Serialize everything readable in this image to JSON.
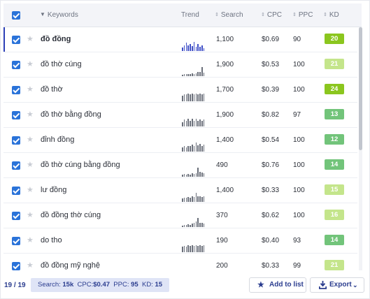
{
  "header": {
    "keywords": "Keywords",
    "trend": "Trend",
    "search": "Search",
    "cpc": "CPC",
    "ppc": "PPC",
    "kd": "KD"
  },
  "rows": [
    {
      "keyword": "đồ đồng",
      "search": "1,100",
      "cpc": "$0.69",
      "ppc": "90",
      "kd": "20",
      "kd_color": "#8bc61e",
      "trend": [
        0.35,
        0.55,
        0.85,
        0.6,
        0.75,
        0.5,
        0.95,
        0.45,
        0.7,
        0.4,
        0.55,
        0.3
      ]
    },
    {
      "keyword": "đồ thờ cúng",
      "search": "1,900",
      "cpc": "$0.53",
      "ppc": "100",
      "kd": "21",
      "kd_color": "#c4e58b",
      "trend": [
        0.15,
        0.2,
        0.2,
        0.25,
        0.2,
        0.3,
        0.25,
        0.3,
        0.4,
        0.45,
        0.95,
        0.35
      ]
    },
    {
      "keyword": "đồ thờ",
      "search": "1,700",
      "cpc": "$0.39",
      "ppc": "100",
      "kd": "24",
      "kd_color": "#8bc61e",
      "trend": [
        0.55,
        0.75,
        0.75,
        0.8,
        0.75,
        0.8,
        0.75,
        0.8,
        0.75,
        0.8,
        0.75,
        0.8
      ]
    },
    {
      "keyword": "đồ thờ bằng đồng",
      "search": "1,900",
      "cpc": "$0.82",
      "ppc": "97",
      "kd": "13",
      "kd_color": "#72c47a",
      "trend": [
        0.4,
        0.75,
        0.6,
        0.8,
        0.6,
        0.8,
        0.6,
        0.8,
        0.6,
        0.75,
        0.6,
        0.7
      ]
    },
    {
      "keyword": "đỉnh đồng",
      "search": "1,400",
      "cpc": "$0.54",
      "ppc": "100",
      "kd": "12",
      "kd_color": "#72c47a",
      "trend": [
        0.4,
        0.55,
        0.45,
        0.6,
        0.55,
        0.7,
        0.6,
        0.9,
        0.65,
        0.8,
        0.6,
        0.7
      ]
    },
    {
      "keyword": "đồ thờ cúng bằng đồng",
      "search": "490",
      "cpc": "$0.76",
      "ppc": "100",
      "kd": "14",
      "kd_color": "#72c47a",
      "trend": [
        0.2,
        0.3,
        0.25,
        0.3,
        0.25,
        0.35,
        0.3,
        0.35,
        0.95,
        0.5,
        0.4,
        0.35
      ]
    },
    {
      "keyword": "lư đồng",
      "search": "1,400",
      "cpc": "$0.33",
      "ppc": "100",
      "kd": "15",
      "kd_color": "#c4e58b",
      "trend": [
        0.35,
        0.45,
        0.4,
        0.5,
        0.45,
        0.55,
        0.5,
        0.95,
        0.55,
        0.6,
        0.5,
        0.55
      ]
    },
    {
      "keyword": "đồ đồng thờ cúng",
      "search": "370",
      "cpc": "$0.62",
      "ppc": "100",
      "kd": "16",
      "kd_color": "#c4e58b",
      "trend": [
        0.15,
        0.25,
        0.2,
        0.3,
        0.25,
        0.35,
        0.4,
        0.55,
        0.95,
        0.45,
        0.4,
        0.35
      ]
    },
    {
      "keyword": "do tho",
      "search": "190",
      "cpc": "$0.40",
      "ppc": "93",
      "kd": "14",
      "kd_color": "#72c47a",
      "trend": [
        0.55,
        0.65,
        0.6,
        0.7,
        0.65,
        0.7,
        0.65,
        0.75,
        0.65,
        0.7,
        0.65,
        0.7
      ]
    },
    {
      "keyword": "đồ đồng mỹ nghệ",
      "search": "200",
      "cpc": "$0.33",
      "ppc": "99",
      "kd": "21",
      "kd_color": "#c4e58b",
      "trend": [
        0.3,
        0.35,
        0.3,
        0.4,
        0.35,
        0.4,
        0.35,
        0.45,
        0.4,
        0.45,
        0.4,
        0.45
      ]
    }
  ],
  "footer": {
    "count": "19 / 19",
    "summary_search_label": "Search:",
    "summary_search": "15k",
    "summary_cpc_label": "CPC:",
    "summary_cpc": "$0.47",
    "summary_ppc_label": "PPC:",
    "summary_ppc": "95",
    "summary_kd_label": "KD:",
    "summary_kd": "15",
    "add_to_list": "Add to list",
    "export": "Export"
  },
  "icons": {
    "star": "star-icon",
    "add_to_list": "star-icon",
    "export": "download-icon",
    "export_chevron": "chevron-down-icon"
  },
  "colors": {
    "accent": "#2a73d9",
    "active_row": "#2c3fb6"
  }
}
